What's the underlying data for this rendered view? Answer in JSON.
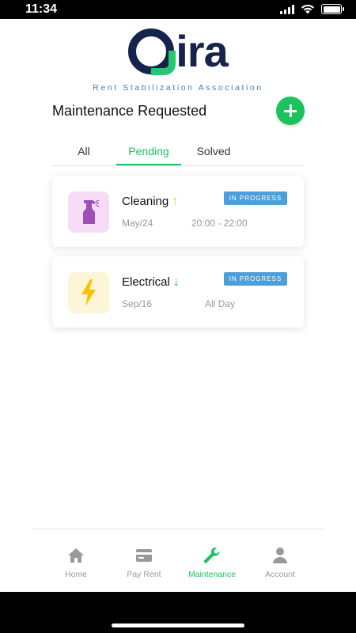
{
  "status_bar": {
    "time": "11:34"
  },
  "logo": {
    "wordmark": "ira",
    "subtitle": "Rent Stabilization Association"
  },
  "header": {
    "title": "Maintenance Requested"
  },
  "tabs": [
    {
      "label": "All",
      "active": false
    },
    {
      "label": "Pending",
      "active": true
    },
    {
      "label": "Solved",
      "active": false
    }
  ],
  "requests": [
    {
      "title": "Cleaning",
      "priority": "high",
      "date": "May/24",
      "time": "20:00 - 22:00",
      "status": "IN PROGRESS",
      "icon": "spray-bottle-icon"
    },
    {
      "title": "Electrical",
      "priority": "low",
      "date": "Sep/16",
      "time": "All Day",
      "status": "IN PROGRESS",
      "icon": "lightning-icon"
    }
  ],
  "bottom_nav": [
    {
      "label": "Home",
      "icon": "home-icon",
      "active": false
    },
    {
      "label": "Pay Rent",
      "icon": "credit-card-icon",
      "active": false
    },
    {
      "label": "Maintenance",
      "icon": "wrench-icon",
      "active": true
    },
    {
      "label": "Account",
      "icon": "person-icon",
      "active": false
    }
  ],
  "colors": {
    "brand_green": "#1dc15e",
    "brand_navy": "#16234a",
    "badge_blue": "#4d9fdc",
    "arrow_high": "#f5c400",
    "arrow_low": "#1dc15e",
    "cleaning_bg": "#f6dcf6",
    "electrical_bg": "#fdf5d8"
  }
}
